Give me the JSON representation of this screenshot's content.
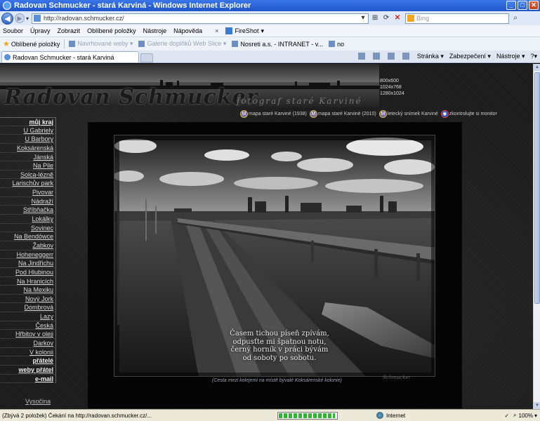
{
  "window": {
    "title": "Radovan Schmucker - stará Karviná - Windows Internet Explorer",
    "buttons": [
      "_",
      "□",
      "✕"
    ]
  },
  "address": {
    "url": "http://radovan.schmucker.cz/",
    "search_placeholder": "Bing"
  },
  "menu": {
    "items": [
      "Soubor",
      "Úpravy",
      "Zobrazit",
      "Oblíbené položky",
      "Nástroje",
      "Nápověda"
    ],
    "close": "×",
    "fireshot": "FireShot",
    "fireshot_arrow": "▾"
  },
  "favorites": {
    "label": "Oblíbené položky",
    "items": [
      {
        "label": "Navrhované weby ▾",
        "dim": true
      },
      {
        "label": "Galerie doplňků Web Slice ▾",
        "dim": true
      },
      {
        "label": "Nosreti a.s. - INTRANET - v..."
      },
      {
        "label": "no"
      }
    ]
  },
  "tab": {
    "label": "Radovan Schmucker - stará Karviná"
  },
  "commands": {
    "items": [
      "Stránka ▾",
      "Zabezpečení ▾",
      "Nástroje ▾",
      "?▾"
    ]
  },
  "site": {
    "title": "Radovan Schmucker",
    "subtitle": "fotograf staré Karviné",
    "resolutions": [
      "800x600",
      "1024x768",
      "1280x1024"
    ],
    "map_links": [
      {
        "icon": "M",
        "label": "mapa staré Karviné (1938)"
      },
      {
        "icon": "M",
        "label": "mapa staré Karviné (2010)"
      },
      {
        "icon": "M",
        "label": "letecký snímek Karviné"
      },
      {
        "icon": "◉",
        "label": "zkontrolujte si monitor"
      }
    ],
    "nav": [
      "můj kraj",
      "U Gabriely",
      "U Barbory",
      "Koksárenská",
      "Jánská",
      "Na Pile",
      "Solca-léznĕ",
      "Larischův park",
      "Pivovar",
      "Nádraží",
      "Stříbňačka",
      "Lokálky",
      "Sovinec",
      "Na Bendówce",
      "Žabkov",
      "Hoheneggerr",
      "Na Jindřichu",
      "Pod Hlubinou",
      "Na Hranicích",
      "Na Mexiku",
      "Nový Jork",
      "Dombrová",
      "Lazy",
      "Česká",
      "Hřbitov v oleji",
      "Darkov",
      "V kolonii",
      "přátelé",
      "weby přátel",
      "e-mail"
    ],
    "nav_bottom": "Vysočina",
    "poem": [
      "Časem tichou píseň zpívám,",
      "odpusťte mi špatnou notu,",
      "černý horník v práci bývám",
      "od soboty po sobotu."
    ],
    "caption": "(Cesta mezi kolejemi na místě bývalé Koksárenské kolonie)",
    "signature": "Schmucker"
  },
  "status": {
    "text": "(Zbývá 2 položek) Čekání na http://radovan.schmucker.cz/...",
    "progress": 0.95,
    "zone": "Internet",
    "zoom": "100%",
    "zoom_arrow": "▾"
  }
}
